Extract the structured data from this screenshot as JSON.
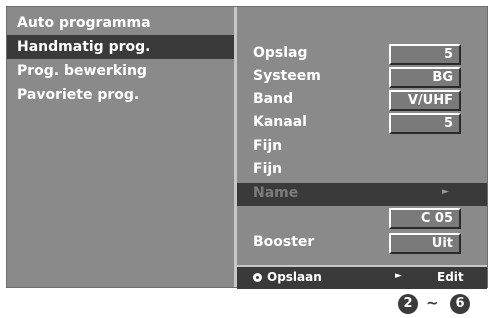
{
  "left_menu": {
    "items": [
      {
        "label": "Auto programma"
      },
      {
        "label": "Handmatig prog."
      },
      {
        "label": "Prog. bewerking"
      },
      {
        "label": "Pavoriete prog."
      }
    ]
  },
  "fields": {
    "opslag": {
      "label": "Opslag",
      "value": "5"
    },
    "systeem": {
      "label": "Systeem",
      "value": "BG"
    },
    "band": {
      "label": "Band",
      "value": "V/UHF"
    },
    "kanaal": {
      "label": "Kanaal",
      "value": "5"
    },
    "fijn1": {
      "label": "Fijn"
    },
    "fijn2": {
      "label": "Fijn"
    },
    "name": {
      "label": "Name",
      "arrow": "►"
    },
    "name_value": {
      "value": "C 05"
    },
    "booster": {
      "label": "Booster",
      "value": "Uit"
    }
  },
  "bottom_bar": {
    "save_label": "Opslaan",
    "play_symbol": "►",
    "edit_label": "Edit"
  },
  "steps": {
    "from": "2",
    "separator": "~",
    "to": "6"
  },
  "icons": {
    "save": "ok-circle-icon",
    "edit": "play-arrow-icon"
  }
}
